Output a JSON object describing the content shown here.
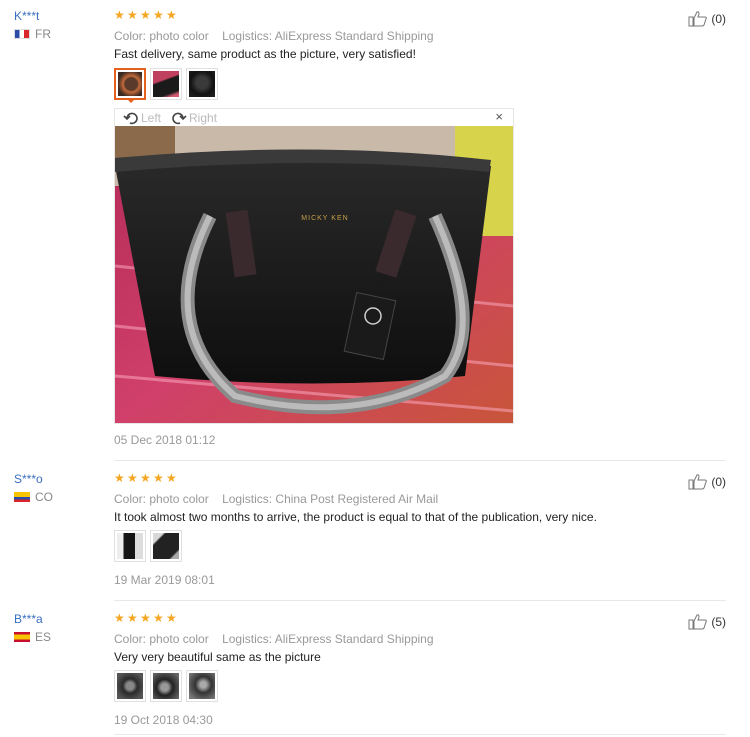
{
  "reviews": [
    {
      "user": "K***t",
      "country": "FR",
      "color": "Color: photo color",
      "logistics": "Logistics: AliExpress Standard Shipping",
      "text": "Fast delivery, same product as the picture, very satisfied!",
      "date": "05 Dec 2018 01:12",
      "likes": "(0)",
      "viewer": {
        "left": "Left",
        "right": "Right",
        "close": "×"
      }
    },
    {
      "user": "S***o",
      "country": "CO",
      "color": "Color: photo color",
      "logistics": "Logistics: China Post Registered Air Mail",
      "text": "It took almost two months to arrive, the product is equal to that of the publication, very nice.",
      "date": "19 Mar 2019 08:01",
      "likes": "(0)"
    },
    {
      "user": "B***a",
      "country": "ES",
      "color": "Color: photo color",
      "logistics": "Logistics: AliExpress Standard Shipping",
      "text": "Very very beautiful same as the picture",
      "date": "19 Oct 2018 04:30",
      "likes": "(5)"
    }
  ],
  "photo_brand": "MICKY KEN",
  "colors": {
    "accent": "#e4611e",
    "star": "#f5a623",
    "link": "#3a6fbf"
  }
}
